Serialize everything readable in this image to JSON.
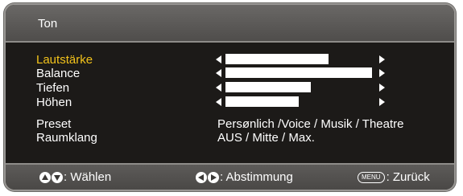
{
  "window": {
    "title": "Ton"
  },
  "menu": {
    "lautstaerke": {
      "label": "Lautstärke",
      "level": 0.69
    },
    "balance": {
      "label": "Balance",
      "level": 0.98
    },
    "tiefen": {
      "label": "Tiefen",
      "level": 0.57
    },
    "hoehen": {
      "label": "Höhen",
      "level": 0.49
    },
    "preset": {
      "label": "Preset",
      "value": "Persønlich /Voice / Musik / Theatre"
    },
    "raumklang": {
      "label": "Raumklang",
      "value": "AUS / Mitte / Max."
    }
  },
  "footer": {
    "select_hint": ": Wählen",
    "adjust_hint": ": Abstimmung",
    "menu_key": "MENU",
    "back_hint": ": Zurück"
  },
  "colors": {
    "selected": "#f2c21a",
    "panel": "#1c1a18",
    "frame": "#9a9895"
  }
}
